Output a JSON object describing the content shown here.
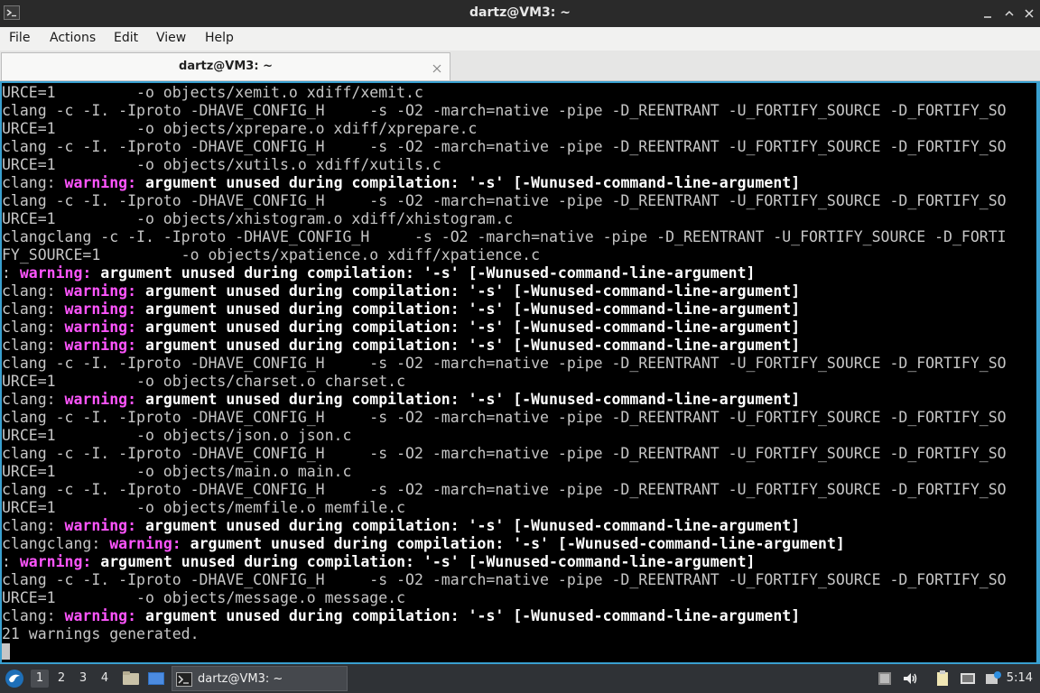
{
  "window": {
    "title": "dartz@VM3: ~"
  },
  "menu": {
    "items": [
      "File",
      "Actions",
      "Edit",
      "View",
      "Help"
    ]
  },
  "tab": {
    "label": "dartz@VM3: ~"
  },
  "terminal": {
    "colors": {
      "background": "#000000",
      "text": "#c6c6c6",
      "warning": "#ff55ff",
      "bold": "#ffffff",
      "frame": "#39a0d0"
    },
    "lines": [
      [
        [
          "URCE=1         -o objects/xemit.o xdiff/xemit.c",
          ""
        ]
      ],
      [
        [
          "clang -c -I. -Iproto -DHAVE_CONFIG_H     -s -O2 -march=native -pipe -D_REENTRANT -U_FORTIFY_SOURCE -D_FORTIFY_SO",
          ""
        ]
      ],
      [
        [
          "URCE=1         -o objects/xprepare.o xdiff/xprepare.c",
          ""
        ]
      ],
      [
        [
          "clang -c -I. -Iproto -DHAVE_CONFIG_H     -s -O2 -march=native -pipe -D_REENTRANT -U_FORTIFY_SOURCE -D_FORTIFY_SO",
          ""
        ]
      ],
      [
        [
          "URCE=1         -o objects/xutils.o xdiff/xutils.c",
          ""
        ]
      ],
      [
        [
          "clang: ",
          ""
        ],
        [
          "warning:",
          "w"
        ],
        [
          " argument unused during compilation: '-s' [-Wunused-command-line-argument]",
          "b"
        ]
      ],
      [
        [
          "clang -c -I. -Iproto -DHAVE_CONFIG_H     -s -O2 -march=native -pipe -D_REENTRANT -U_FORTIFY_SOURCE -D_FORTIFY_SO",
          ""
        ]
      ],
      [
        [
          "URCE=1         -o objects/xhistogram.o xdiff/xhistogram.c",
          ""
        ]
      ],
      [
        [
          "clangclang -c -I. -Iproto -DHAVE_CONFIG_H     -s -O2 -march=native -pipe -D_REENTRANT -U_FORTIFY_SOURCE -D_FORTI",
          ""
        ]
      ],
      [
        [
          "FY_SOURCE=1         -o objects/xpatience.o xdiff/xpatience.c",
          ""
        ]
      ],
      [
        [
          ": ",
          ""
        ],
        [
          "warning:",
          "w"
        ],
        [
          " argument unused during compilation: '-s' [-Wunused-command-line-argument]",
          "b"
        ]
      ],
      [
        [
          "clang: ",
          ""
        ],
        [
          "warning:",
          "w"
        ],
        [
          " argument unused during compilation: '-s' [-Wunused-command-line-argument]",
          "b"
        ]
      ],
      [
        [
          "clang: ",
          ""
        ],
        [
          "warning:",
          "w"
        ],
        [
          " argument unused during compilation: '-s' [-Wunused-command-line-argument]",
          "b"
        ]
      ],
      [
        [
          "clang: ",
          ""
        ],
        [
          "warning:",
          "w"
        ],
        [
          " argument unused during compilation: '-s' [-Wunused-command-line-argument]",
          "b"
        ]
      ],
      [
        [
          "clang: ",
          ""
        ],
        [
          "warning:",
          "w"
        ],
        [
          " argument unused during compilation: '-s' [-Wunused-command-line-argument]",
          "b"
        ]
      ],
      [
        [
          "clang -c -I. -Iproto -DHAVE_CONFIG_H     -s -O2 -march=native -pipe -D_REENTRANT -U_FORTIFY_SOURCE -D_FORTIFY_SO",
          ""
        ]
      ],
      [
        [
          "URCE=1         -o objects/charset.o charset.c",
          ""
        ]
      ],
      [
        [
          "clang: ",
          ""
        ],
        [
          "warning:",
          "w"
        ],
        [
          " argument unused during compilation: '-s' [-Wunused-command-line-argument]",
          "b"
        ]
      ],
      [
        [
          "clang -c -I. -Iproto -DHAVE_CONFIG_H     -s -O2 -march=native -pipe -D_REENTRANT -U_FORTIFY_SOURCE -D_FORTIFY_SO",
          ""
        ]
      ],
      [
        [
          "URCE=1         -o objects/json.o json.c",
          ""
        ]
      ],
      [
        [
          "clang -c -I. -Iproto -DHAVE_CONFIG_H     -s -O2 -march=native -pipe -D_REENTRANT -U_FORTIFY_SOURCE -D_FORTIFY_SO",
          ""
        ]
      ],
      [
        [
          "URCE=1         -o objects/main.o main.c",
          ""
        ]
      ],
      [
        [
          "clang -c -I. -Iproto -DHAVE_CONFIG_H     -s -O2 -march=native -pipe -D_REENTRANT -U_FORTIFY_SOURCE -D_FORTIFY_SO",
          ""
        ]
      ],
      [
        [
          "URCE=1         -o objects/memfile.o memfile.c",
          ""
        ]
      ],
      [
        [
          "clang: ",
          ""
        ],
        [
          "warning:",
          "w"
        ],
        [
          " argument unused during compilation: '-s' [-Wunused-command-line-argument]",
          "b"
        ]
      ],
      [
        [
          "clangclang: ",
          ""
        ],
        [
          "warning:",
          "w"
        ],
        [
          " argument unused during compilation: '-s' [-Wunused-command-line-argument]",
          "b"
        ]
      ],
      [
        [
          ": ",
          ""
        ],
        [
          "warning:",
          "w"
        ],
        [
          " argument unused during compilation: '-s' [-Wunused-command-line-argument]",
          "b"
        ]
      ],
      [
        [
          "clang -c -I. -Iproto -DHAVE_CONFIG_H     -s -O2 -march=native -pipe -D_REENTRANT -U_FORTIFY_SOURCE -D_FORTIFY_SO",
          ""
        ]
      ],
      [
        [
          "URCE=1         -o objects/message.o message.c",
          ""
        ]
      ],
      [
        [
          "clang: ",
          ""
        ],
        [
          "warning:",
          "w"
        ],
        [
          " argument unused during compilation: '-s' [-Wunused-command-line-argument]",
          "b"
        ]
      ],
      [
        [
          "21 warnings generated.",
          ""
        ]
      ]
    ]
  },
  "taskbar": {
    "workspaces": [
      "1",
      "2",
      "3",
      "4"
    ],
    "active_workspace": "1",
    "task_label": "dartz@VM3: ~",
    "clock": "5:14",
    "icons": [
      "start-menu-icon",
      "file-manager-icon",
      "show-desktop-icon",
      "terminal-icon",
      "volume-icon",
      "clipboard-icon",
      "network-icon",
      "notifications-icon"
    ]
  }
}
